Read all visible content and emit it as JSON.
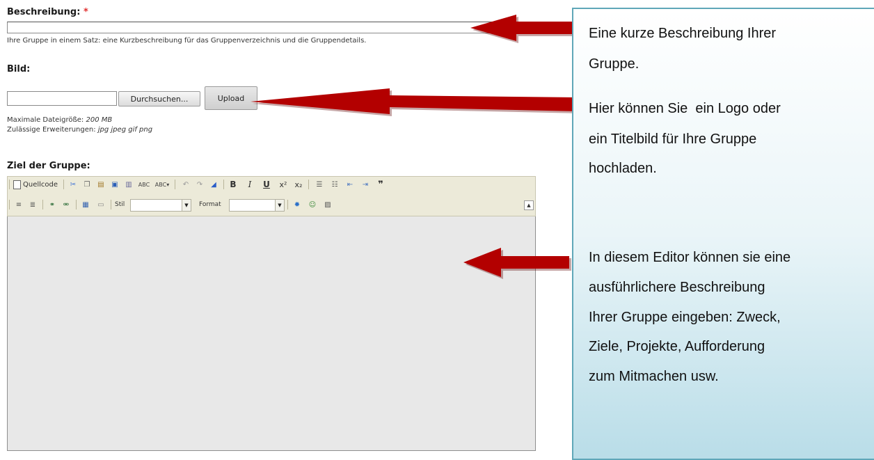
{
  "form": {
    "description": {
      "label": "Beschreibung:",
      "required_mark": "*",
      "value": "",
      "help": "Ihre Gruppe in einem Satz: eine Kurzbeschreibung für das Gruppenverzeichnis und die Gruppendetails."
    },
    "image": {
      "label": "Bild:",
      "file_value": "",
      "browse_label": "Durchsuchen...",
      "upload_label": "Upload",
      "max_size_label": "Maximale Dateigröße:",
      "max_size_value": "200 MB",
      "extensions_label": "Zulässige Erweiterungen:",
      "extensions_value": "jpg jpeg gif png"
    },
    "goal": {
      "label": "Ziel der Gruppe:"
    }
  },
  "editor": {
    "source_label": "Quellcode",
    "style_label": "Stil",
    "style_value": "",
    "format_label": "Format",
    "format_value": "",
    "icons": [
      "source-icon",
      "paste-icon",
      "copy-icon",
      "paste-text-icon",
      "paste-word-icon",
      "spellcheck-icon",
      "spellcheck-menu-icon",
      "undo-icon",
      "redo-icon",
      "remove-format-icon",
      "bold-icon",
      "italic-icon",
      "underline-icon",
      "superscript-icon",
      "subscript-icon",
      "numbered-list-icon",
      "bulleted-list-icon",
      "outdent-icon",
      "indent-icon",
      "blockquote-icon",
      "align-left-icon",
      "align-center-icon",
      "link-icon",
      "unlink-icon",
      "table-icon",
      "horizontal-rule-icon",
      "flash-icon",
      "smiley-icon",
      "image-icon",
      "collapse-toolbar-icon"
    ]
  },
  "callouts": {
    "c1": {
      "line1": "Eine kurze Beschreibung Ihrer",
      "line2": "Gruppe."
    },
    "c2": {
      "line1": "Hier können Sie  ein Logo oder",
      "line2": "ein Titelbild für Ihre Gruppe",
      "line3": "hochladen."
    },
    "c3": {
      "line1": "In diesem Editor können sie eine",
      "line2": "ausführlichere Beschreibung",
      "line3": "Ihrer Gruppe eingeben: Zweck,",
      "line4": "Ziele, Projekte, Aufforderung",
      "line5": "zum Mitmachen usw."
    }
  },
  "colors": {
    "arrow": "#b30000",
    "callout_border": "#5fa7b8",
    "editor_bg": "#e8e8e8",
    "required": "#e03030"
  }
}
